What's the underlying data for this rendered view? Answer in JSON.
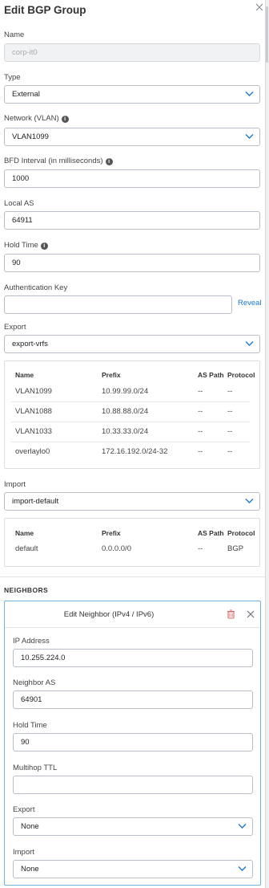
{
  "header": {
    "title": "Edit BGP Group"
  },
  "form": {
    "name": {
      "label": "Name",
      "value": "corp-it0"
    },
    "type": {
      "label": "Type",
      "value": "External"
    },
    "network": {
      "label": "Network (VLAN)",
      "value": "VLAN1099"
    },
    "bfd": {
      "label": "BFD Interval (in milliseconds)",
      "value": "1000"
    },
    "local_as": {
      "label": "Local AS",
      "value": "64911"
    },
    "hold_time": {
      "label": "Hold Time",
      "value": "90"
    },
    "auth_key": {
      "label": "Authentication Key",
      "value": "",
      "reveal": "Reveal"
    },
    "export": {
      "label": "Export",
      "value": "export-vrfs"
    },
    "import": {
      "label": "Import",
      "value": "import-default"
    }
  },
  "export_table": {
    "columns": [
      "Name",
      "Prefix",
      "AS Path",
      "Protocol"
    ],
    "rows": [
      [
        "VLAN1099",
        "10.99.99.0/24",
        "--",
        "--"
      ],
      [
        "VLAN1088",
        "10.88.88.0/24",
        "--",
        "--"
      ],
      [
        "VLAN1033",
        "10.33.33.0/24",
        "--",
        "--"
      ],
      [
        "overlaylo0",
        "172.16.192.0/24-32",
        "--",
        "--"
      ]
    ]
  },
  "import_table": {
    "columns": [
      "Name",
      "Prefix",
      "AS Path",
      "Protocol"
    ],
    "rows": [
      [
        "default",
        "0.0.0.0/0",
        "--",
        "BGP"
      ]
    ]
  },
  "neighbors": {
    "section_title": "NEIGHBORS",
    "card_title": "Edit Neighbor (IPv4 / IPv6)",
    "ip": {
      "label": "IP Address",
      "value": "10.255.224.0"
    },
    "neighbor_as": {
      "label": "Neighbor AS",
      "value": "64901"
    },
    "hold_time": {
      "label": "Hold Time",
      "value": "90"
    },
    "multihop": {
      "label": "Multihop TTL",
      "value": ""
    },
    "export": {
      "label": "Export",
      "value": "None"
    },
    "import": {
      "label": "Import",
      "value": "None"
    }
  },
  "icons": {
    "close": "close-icon",
    "info": "info-icon",
    "chevron": "chevron-down-icon",
    "trash": "trash-icon"
  },
  "colors": {
    "accent": "#1b78c8",
    "card_border": "#6db6df",
    "trash": "#e06a6a"
  }
}
